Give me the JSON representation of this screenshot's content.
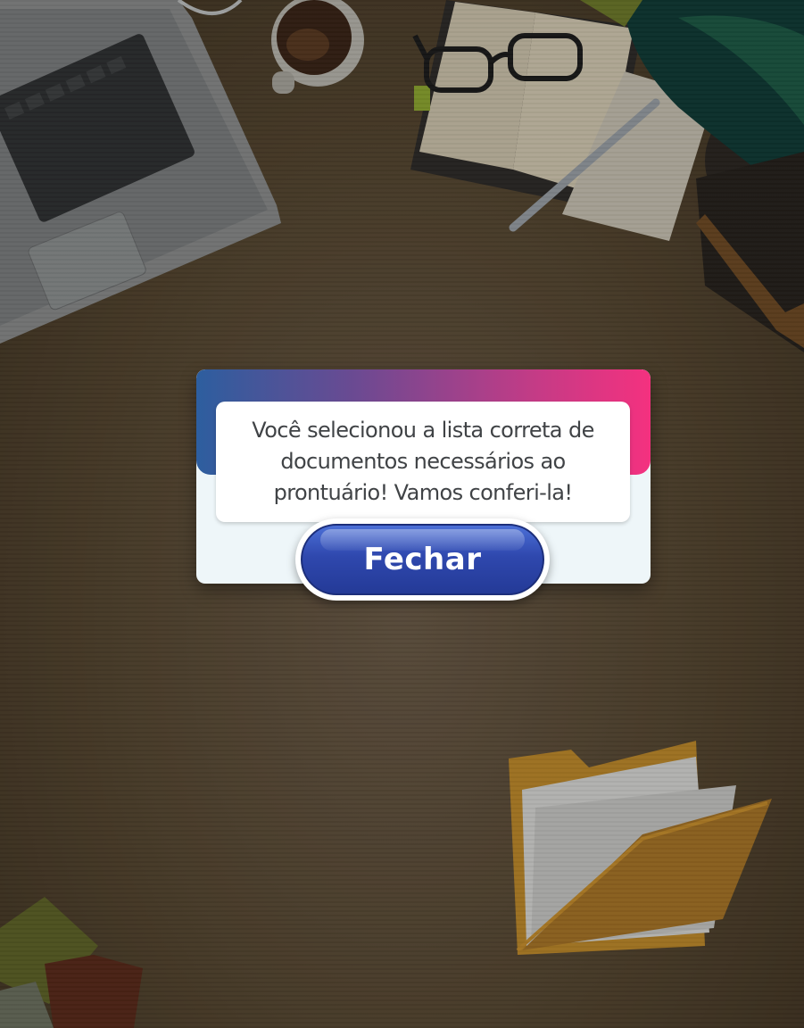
{
  "dialog": {
    "message": "Você selecionou a lista correta de documentos necessários ao prontuário! Vamos conferi-la!",
    "close_label": "Fechar",
    "header_gradient": [
      "#2d5e9f",
      "#6b4a92",
      "#c53b86",
      "#f4317f"
    ],
    "button_color": "#2f48ae"
  },
  "background": {
    "objects": [
      "laptop",
      "coffee-cup",
      "notebook",
      "glasses",
      "pen",
      "plant",
      "books",
      "folder",
      "sticky-notes"
    ]
  }
}
